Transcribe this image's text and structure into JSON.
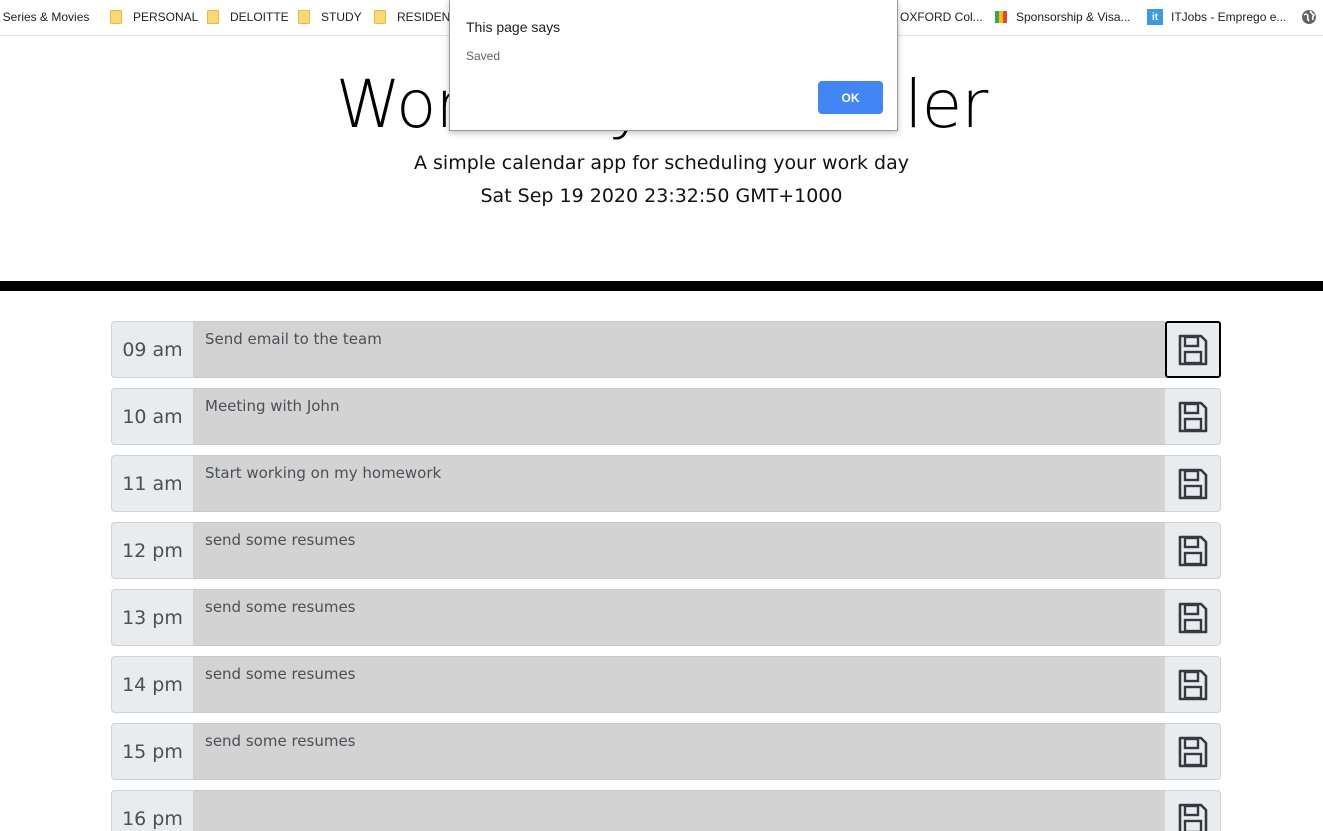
{
  "bookmarks": [
    {
      "label": "/ Series & Movies",
      "icon": "none"
    },
    {
      "label": "PERSONAL",
      "icon": "folder-icon"
    },
    {
      "label": "DELOITTE",
      "icon": "folder-icon"
    },
    {
      "label": "STUDY",
      "icon": "folder-icon"
    },
    {
      "label": "RESIDENC",
      "icon": "folder-icon"
    },
    {
      "label": "OXFORD Col...",
      "icon": "none"
    },
    {
      "label": "Sponsorship & Visa...",
      "icon": "multicolor-favicon"
    },
    {
      "label": "ITJobs - Emprego e...",
      "icon": "it-favicon"
    }
  ],
  "header": {
    "title": "Work Day Scheduler",
    "lead": "A simple calendar app for scheduling your work day",
    "current_day": "Sat Sep 19 2020 23:32:50 GMT+1000"
  },
  "time_blocks": [
    {
      "hour": "09 am",
      "description": "Send email to the team"
    },
    {
      "hour": "10 am",
      "description": "Meeting with John"
    },
    {
      "hour": "11 am",
      "description": "Start working on my homework"
    },
    {
      "hour": "12 pm",
      "description": "send some resumes"
    },
    {
      "hour": "13 pm",
      "description": "send some resumes"
    },
    {
      "hour": "14 pm",
      "description": "send some resumes"
    },
    {
      "hour": "15 pm",
      "description": "send some resumes"
    },
    {
      "hour": "16 pm",
      "description": ""
    }
  ],
  "dialog": {
    "title": "This page says",
    "message": "Saved",
    "ok_label": "OK"
  },
  "colors": {
    "past_block": "#d3d3d3",
    "hour_bg": "#e9ecef",
    "divider": "#000000",
    "ok_button": "#4285f4",
    "folder": "#fbd776"
  }
}
